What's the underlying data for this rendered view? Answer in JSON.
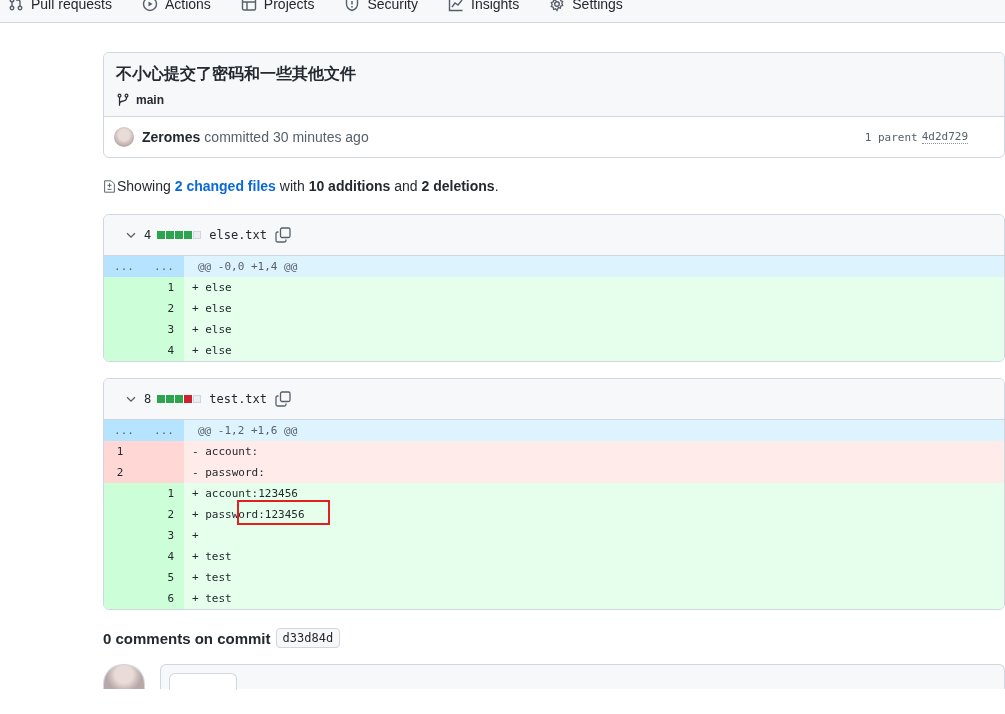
{
  "nav_tabs": [
    {
      "label": "Pull requests"
    },
    {
      "label": "Actions"
    },
    {
      "label": "Projects"
    },
    {
      "label": "Security"
    },
    {
      "label": "Insights"
    },
    {
      "label": "Settings"
    }
  ],
  "commit": {
    "title": "不小心提交了密码和一些其他文件",
    "branch": "main",
    "author": "Zeromes",
    "action": "committed",
    "time": "30 minutes ago",
    "parent_label": "1 parent",
    "parent_sha": "4d2d729"
  },
  "summary": {
    "prefix": "Showing",
    "link": "2 changed files",
    "middle": "with **10 additions** and **2 deletions**."
  },
  "files": [
    {
      "changes": "4",
      "expanded": true,
      "stat": [
        {
          "kind": "added"
        },
        {
          "kind": "added"
        },
        {
          "kind": "added"
        },
        {
          "kind": "added"
        },
        {
          "kind": "neutral"
        }
      ],
      "name": "else.txt",
      "lines": [
        {
          "kind": "hunk",
          "old": "...",
          "new": "...",
          "text": "@@ -0,0 +1,4 @@"
        },
        {
          "kind": "add",
          "new": "1",
          "text": "+ else"
        },
        {
          "kind": "add",
          "new": "2",
          "text": "+ else"
        },
        {
          "kind": "add",
          "new": "3",
          "text": "+ else"
        },
        {
          "kind": "add",
          "new": "4",
          "text": "+ else"
        }
      ]
    },
    {
      "changes": "8",
      "expanded": true,
      "stat": [
        {
          "kind": "added"
        },
        {
          "kind": "added"
        },
        {
          "kind": "added"
        },
        {
          "kind": "deleted"
        },
        {
          "kind": "neutral"
        }
      ],
      "name": "test.txt",
      "lines": [
        {
          "kind": "hunk",
          "old": "...",
          "new": "...",
          "text": "@@ -1,2 +1,6 @@"
        },
        {
          "kind": "del",
          "old": "1",
          "text": "- account:"
        },
        {
          "kind": "del",
          "old": "2",
          "text": "- password:"
        },
        {
          "kind": "add",
          "new": "1",
          "text": "+ account:123456"
        },
        {
          "kind": "add",
          "new": "2",
          "text": "+ password:123456",
          "highlighted": true
        },
        {
          "kind": "add",
          "new": "3",
          "text": "+"
        },
        {
          "kind": "add",
          "new": "4",
          "text": "+ test"
        },
        {
          "kind": "add",
          "new": "5",
          "text": "+ test"
        },
        {
          "kind": "add",
          "new": "6",
          "text": "+ test"
        }
      ]
    }
  ],
  "comments": {
    "count_text": "0 comments on commit",
    "sha": "d33d84d"
  }
}
